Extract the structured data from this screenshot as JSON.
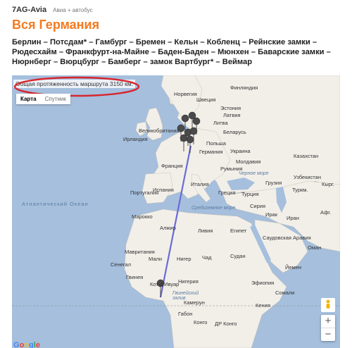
{
  "header": {
    "brand": "7AG-Avia",
    "subtitle": "Авиа + автобус"
  },
  "title": "Вся Германия",
  "route_text": "Берлин – Потсдам* – Гамбург – Бремен – Кельн – Кобленц – Рейнские замки – Рюдесхайм – Франкфурт-на-Майне – Баден-Баден – Мюнхен – Баварские замки – Нюрнберг – Вюрцбург – Бамберг – замок Вартбург* – Веймар",
  "map": {
    "total_distance": "Общая протяженность маршрута 3150 км.",
    "maptype": {
      "map": "Карта",
      "satellite": "Спутник"
    },
    "zoom_in": "+",
    "zoom_out": "−",
    "google": "Google",
    "colors": {
      "water": "#a5bfdd",
      "land": "#f2efe9",
      "route": "#6b6bd6",
      "oval": "#d7262e"
    },
    "labels": {
      "finland": "Финляндия",
      "norway": "Норвегия",
      "sweden": "Швеция",
      "estonia": "Эстония",
      "latvia": "Латвия",
      "lithuania": "Литва",
      "belarus": "Беларусь",
      "ukraine": "Украина",
      "kazakhstan": "Казахстан",
      "uzbekistan": "Узбекистан",
      "turkmenistan": "Туркм.",
      "kyrgyz": "Кырг.",
      "uk": "Великобритания",
      "ireland": "Ирландия",
      "poland": "Польша",
      "germany": "Германия",
      "france": "Франция",
      "spain": "Испания",
      "portugal": "Португалия",
      "italy": "Италия",
      "romania": "Румыния",
      "moldova": "Молдавия",
      "greece": "Греция",
      "turkey": "Турция",
      "georgia": "Грузия",
      "syria": "Сирия",
      "iraq": "Ирак",
      "iran": "Иран",
      "afgh": "Афг.",
      "black_sea": "Черное море",
      "med_sea": "Средиземное море",
      "morocco": "Марокко",
      "algeria": "Алжир",
      "libya": "Ливия",
      "egypt": "Египет",
      "saudi": "Саудовская Аравия",
      "oman": "Оман",
      "yemen": "Йемен",
      "mauritania": "Мавритания",
      "mali": "Мали",
      "niger": "Нигер",
      "chad": "Чад",
      "sudan": "Судан",
      "ethiopia": "Эфиопия",
      "somalia": "Сомали",
      "kenya": "Кения",
      "nigeria": "Нигерия",
      "cameroon": "Камерун",
      "senegal": "Сенегал",
      "guinea": "Гвинея",
      "cote": "Кот-д'Ивуар",
      "gabon": "Габон",
      "congo": "Конго",
      "drc": "ДР Конго",
      "atlantic": "Атлантический Океан",
      "gulf_guinea": "Гвинейский залив"
    }
  }
}
